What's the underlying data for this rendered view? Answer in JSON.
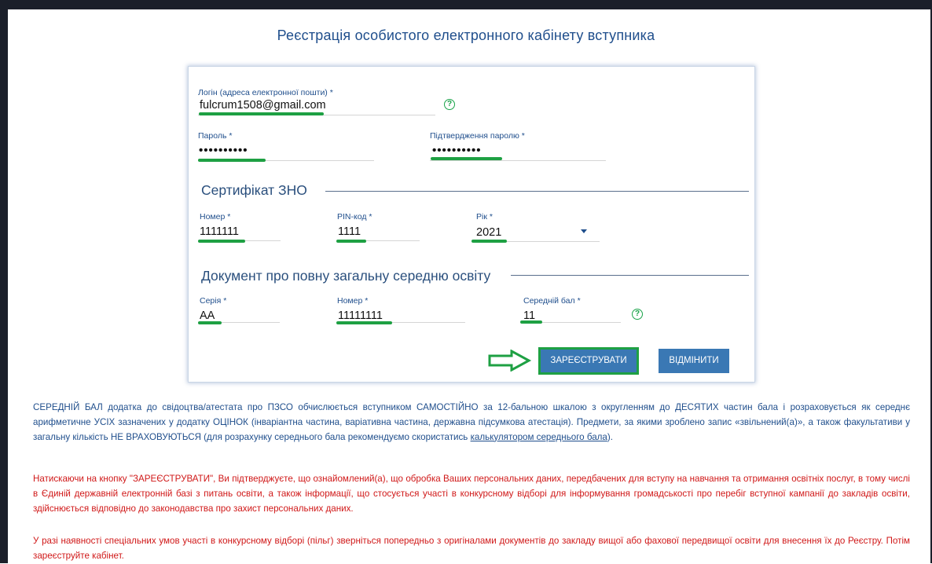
{
  "page": {
    "title": "Реєстрація особистого електронного кабінету вступника"
  },
  "account": {
    "login_label": "Логін (адреса електронної пошти) *",
    "login_value": "fulcrum1508@gmail.com",
    "password_label": "Пароль *",
    "password_value": "••••••••••",
    "password_confirm_label": "Підтвердження паролю *",
    "password_confirm_value": "••••••••••"
  },
  "certificate": {
    "heading": "Сертифікат ЗНО",
    "number_label": "Номер *",
    "number_value": "1111111",
    "pin_label": "PIN-код *",
    "pin_value": "1111",
    "year_label": "Рік *",
    "year_value": "2021"
  },
  "education_document": {
    "heading": "Документ про повну загальну середню освіту",
    "series_label": "Серія *",
    "series_value": "АА",
    "number_label": "Номер *",
    "number_value": "11111111",
    "gpa_label": "Середній бал *",
    "gpa_value": "11"
  },
  "buttons": {
    "register": "ЗАРЕЄСТРУВАТИ",
    "cancel": "ВІДМІНИТИ"
  },
  "notes": {
    "gpa_note_before_link": "СЕРЕДНІЙ БАЛ додатка до свідоцтва/атестата про ПЗСО обчислюється вступником САМОСТІЙНО за 12-бальною шкалою з округленням до ДЕСЯТИХ частин бала і розраховується як середнє арифметичне УСІХ зазначених у додатку ОЦІНОК (інваріантна частина, варіативна частина, державна підсумкова атестація). Предмети, за якими зроблено запис «звільнений(а)», а також факультативи у загальну кількість НЕ ВРАХОВУЮТЬСЯ (для розрахунку середнього бала рекомендуємо скористатись ",
    "gpa_note_link": "калькулятором середнього бала",
    "gpa_note_after_link": ").",
    "consent_note": "Натискаючи на кнопку \"ЗАРЕЄСТРУВАТИ\", Ви підтверджуєте, що ознайомлений(а), що обробка Ваших персональних даних, передбачених для вступу на навчання та отримання освітніх послуг, в тому числі в Єдиній державній електронній базі з питань освіти, а також інформації, що стосується участі в конкурсному відборі для інформування громадськості про перебіг вступної кампанії до закладів освіти, здійснюється відповідно до законодавства про захист персональних даних.",
    "special_conditions_note": "У разі наявності спеціальних умов участі в конкурсному відборі (пільг) зверніться попередньо з оригіналами документів до закладу вищої або фахової передвищої освіти для внесення їх до Реєстру. Потім зареєструйте кабінет."
  },
  "colors": {
    "accent": "#1f4e8c",
    "button": "#3a78b4",
    "highlight_green": "#1ea043",
    "warning_red": "#d01818"
  },
  "icons": [
    "help-icon",
    "arrow-right-icon",
    "chevron-down-icon"
  ]
}
